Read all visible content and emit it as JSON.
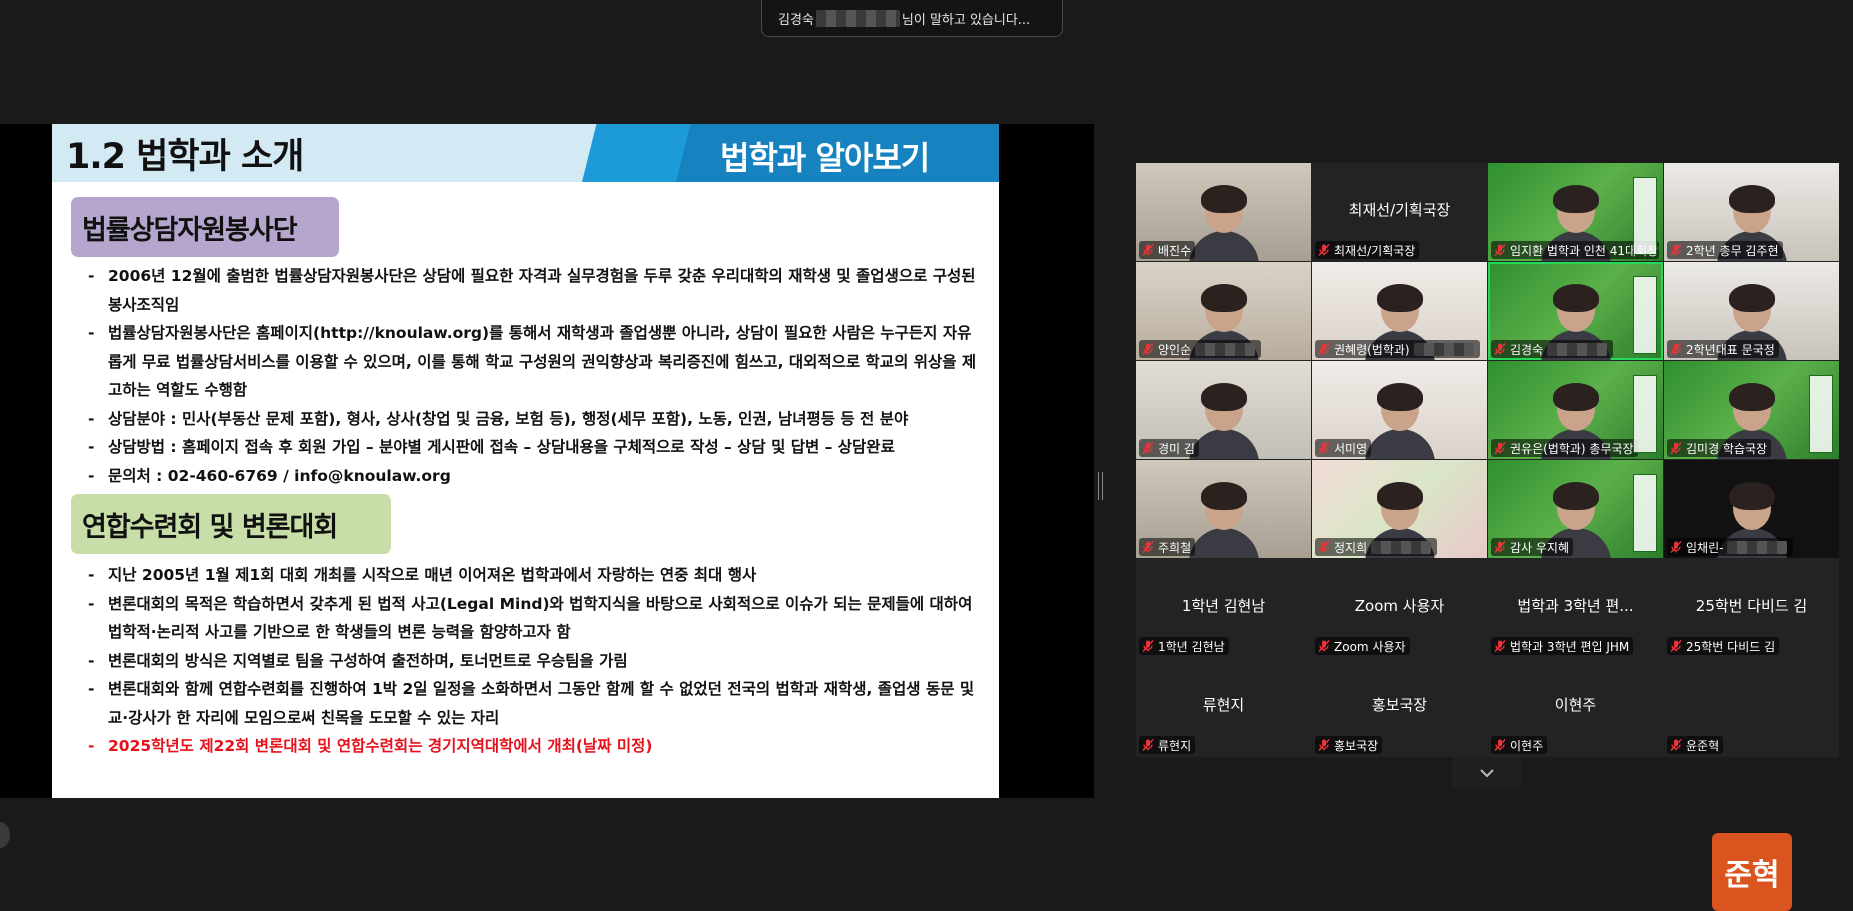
{
  "speaker_banner": {
    "name": "김경숙",
    "suffix": "님이 말하고 있습니다..."
  },
  "slide": {
    "title": "1.2 법학과 소개",
    "header_tag": "법학과 알아보기",
    "section1": {
      "heading": "법률상담자원봉사단",
      "bullets": [
        {
          "dash": "-",
          "text": "2006년 12월에 출범한 법률상담자원봉사단은 상담에 필요한 자격과 실무경험을 두루 갖춘 우리대학의 재학생 및 졸업생으로 구성된 봉사조직임"
        },
        {
          "dash": "-",
          "text": "법률상담자원봉사단은 홈페이지(http://knoulaw.org)를 통해서 재학생과 졸업생뿐 아니라, 상담이 필요한 사람은 누구든지 자유롭게 무료 법률상담서비스를 이용할 수 있으며, 이를 통해 학교 구성원의 권익향상과 복리증진에 힘쓰고, 대외적으로 학교의 위상을 제고하는 역할도 수행함"
        },
        {
          "dash": "-",
          "text": "상담분야 : 민사(부동산 문제 포함), 형사, 상사(창업 및 금융, 보험 등), 행정(세무 포함), 노동, 인권, 남녀평등 등 전 분야"
        },
        {
          "dash": "-",
          "text": "상담방법 : 홈페이지 접속 후 회원 가입 – 분야별 게시판에 접속 – 상담내용을 구체적으로 작성 – 상담 및 답변 – 상담완료"
        },
        {
          "dash": "-",
          "text": "문의처 : 02-460-6769 / info@knoulaw.org"
        }
      ]
    },
    "section2": {
      "heading": "연합수련회 및 변론대회",
      "bullets": [
        {
          "dash": "-",
          "text": "지난 2005년 1월 제1회 대회 개최를 시작으로 매년 이어져온 법학과에서 자랑하는 연중 최대 행사"
        },
        {
          "dash": "-",
          "text": "변론대회의 목적은 학습하면서 갖추게 된 법적 사고(Legal Mind)와 법학지식을 바탕으로 사회적으로 이슈가 되는 문제들에 대하여 법학적·논리적 사고를 기반으로 한 학생들의 변론 능력을 함양하고자 함"
        },
        {
          "dash": "-",
          "text": "변론대회의 방식은 지역별로 팀을 구성하여 출전하며, 토너먼트로 우승팀을 가림"
        },
        {
          "dash": "-",
          "text": "변론대회와 함께 연합수련회를 진행하여 1박 2일 일정을 소화하면서 그동안 함께 할 수 없었던 전국의 법학과 재학생, 졸업생 동문 및 교·강사가 한 자리에 모임으로써 친목을 도모할 수 있는 자리"
        }
      ],
      "notice": {
        "dash": "-",
        "text": "2025학년도 제22회 변론대회 및 연합수련회는 경기지역대학에서 개최(날짜 미정)"
      }
    }
  },
  "participants": [
    {
      "label": "배진수",
      "center": "",
      "style": "room1"
    },
    {
      "label": "최재선/기획국장",
      "center": "최재선/기획국장",
      "style": ""
    },
    {
      "label": "임지환 법학과 인천 41대회장",
      "center": "",
      "style": "green"
    },
    {
      "label": "2학년 총무 김주현",
      "center": "",
      "style": "room2"
    },
    {
      "label": "양인순",
      "center": "",
      "style": "room3"
    },
    {
      "label": "권혜령(법학과)",
      "center": "",
      "style": "room4"
    },
    {
      "label": "김경숙",
      "center": "",
      "style": "green"
    },
    {
      "label": "2학년대표 문국정",
      "center": "",
      "style": "room2"
    },
    {
      "label": "경미 김",
      "center": "",
      "style": "room5"
    },
    {
      "label": "서미영",
      "center": "",
      "style": "room4"
    },
    {
      "label": "권유은(법학과) 총무국장",
      "center": "",
      "style": "green"
    },
    {
      "label": "김미경 학습국장",
      "center": "",
      "style": "green"
    },
    {
      "label": "주희철",
      "center": "",
      "style": "room1"
    },
    {
      "label": "정지희",
      "center": "",
      "style": "floral"
    },
    {
      "label": "감사 우지혜",
      "center": "",
      "style": "green"
    },
    {
      "label": "임채린-",
      "center": "",
      "style": "dark"
    },
    {
      "label": "1학년 김현남",
      "center": "1학년 김현남",
      "style": ""
    },
    {
      "label": "Zoom 사용자",
      "center": "Zoom 사용자",
      "style": ""
    },
    {
      "label": "법학과 3학년 편입 JHM",
      "center": "법학과 3학년 편...",
      "style": ""
    },
    {
      "label": "25학번 다비드 김",
      "center": "25학번 다비드 김",
      "style": ""
    },
    {
      "label": "류현지",
      "center": "류현지",
      "style": ""
    },
    {
      "label": "홍보국장",
      "center": "홍보국장",
      "style": ""
    },
    {
      "label": "이현주",
      "center": "이현주",
      "style": ""
    },
    {
      "label": "윤준혁",
      "center": "",
      "style": ""
    }
  ],
  "avatar_initials": "준혁",
  "colors": {
    "active_speaker": "#23d959",
    "muted_icon": "#e8353b",
    "avatar": "#d9541e"
  }
}
